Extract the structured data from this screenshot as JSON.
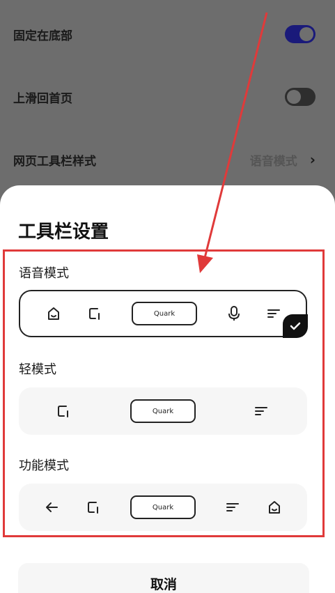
{
  "settings": {
    "rows": [
      {
        "label": "固定在底部",
        "toggle": "on"
      },
      {
        "label": "上滑回首页",
        "toggle": "off"
      },
      {
        "label": "网页工具栏样式",
        "value": "语音模式"
      }
    ]
  },
  "sheet": {
    "title": "工具栏设置",
    "modes": [
      {
        "title": "语音模式",
        "selected": true,
        "search_label": "Quark",
        "icons": [
          "home-icon",
          "tabs-icon",
          "mic-icon",
          "menu-icon"
        ]
      },
      {
        "title": "轻模式",
        "selected": false,
        "search_label": "Quark",
        "icons": [
          "tabs-icon",
          "menu-icon"
        ]
      },
      {
        "title": "功能模式",
        "selected": false,
        "search_label": "Quark",
        "icons": [
          "back-arrow-icon",
          "tabs-icon",
          "menu-icon",
          "home-icon"
        ]
      }
    ],
    "cancel_label": "取消"
  },
  "colors": {
    "annotation": "#e03a3a",
    "toggle_on": "#1a1a7a",
    "selected_border": "#222222"
  }
}
